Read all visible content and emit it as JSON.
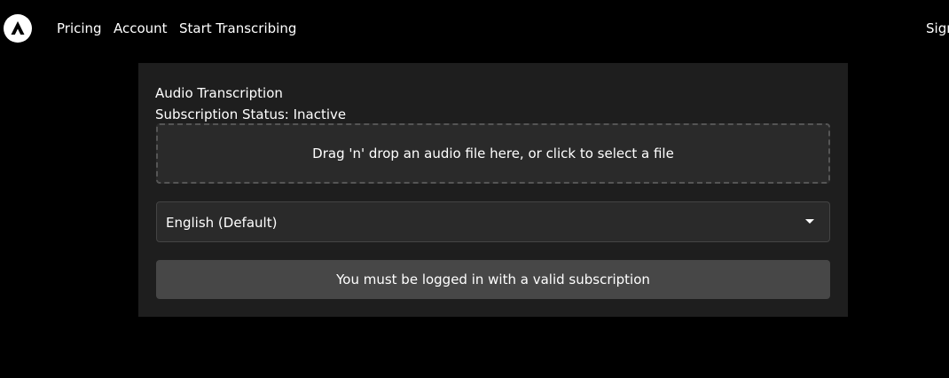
{
  "nav": {
    "links": [
      "Pricing",
      "Account",
      "Start Transcribing"
    ],
    "signin_label": "Sign in",
    "logo_icon": "triangle-logo-icon"
  },
  "card": {
    "title": "Audio Transcription",
    "status": "Subscription Status: Inactive",
    "dropzone_text": "Drag 'n' drop an audio file here, or click to select a file",
    "language_select": {
      "value": "English (Default)",
      "icon": "chevron-down-icon"
    },
    "submit_label": "You must be logged in with a valid subscription",
    "submit_enabled": false
  },
  "colors": {
    "page_bg": "#000000",
    "panel_bg": "#1e1e1e",
    "field_bg": "#2a2a2a",
    "button_bg": "#474747",
    "text": "#ffffff"
  }
}
